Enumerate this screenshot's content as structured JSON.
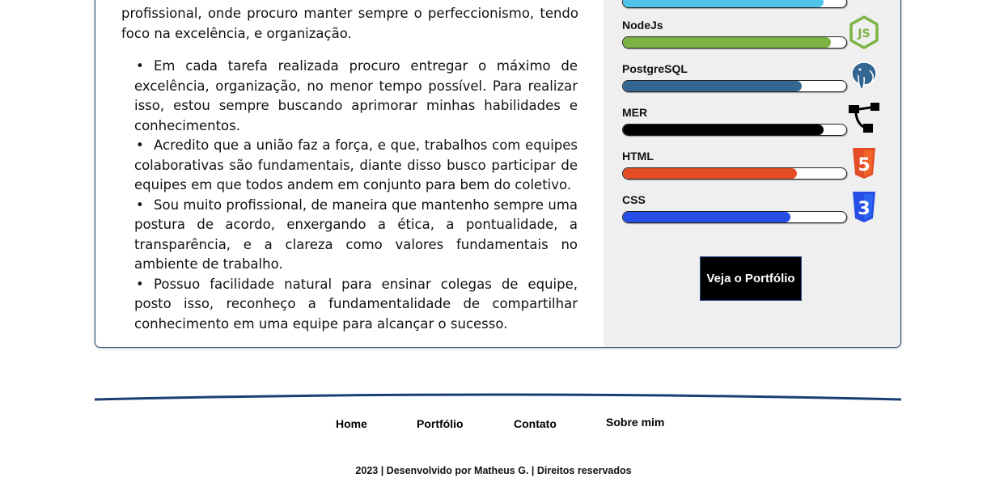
{
  "about": {
    "intro": "profissional, onde procuro manter sempre o perfeccionismo, tendo foco na excelência, e organização.",
    "bullets": [
      "Em cada tarefa realizada procuro entregar o máximo de excelência, organização, no menor tempo possível. Para realizar isso, estou sempre buscando aprimorar minhas habilidades e conhecimentos.",
      "Acredito que a união faz a força, e que, trabalhos com equipes colaborativas são fundamentais, diante disso busco participar de equipes em que todos andem em conjunto para bem do coletivo.",
      "Sou muito profissional, de maneira que mantenho sempre uma postura de acordo, enxergando a ética, a pontualidade, a transparência, e a clareza como valores fundamentais no ambiente de trabalho.",
      "Possuo facilidade natural para ensinar colegas de equipe, posto isso, reconheço a fundamentalidade de compartilhar conhecimento em uma equipe para alcançar o sucesso."
    ],
    "bullet_symbol": "•"
  },
  "skills": [
    {
      "name": "",
      "level": 0.9,
      "color": "#4ec4e8",
      "icon": "partial-skill-icon"
    },
    {
      "name": "NodeJs",
      "level": 0.93,
      "color": "#7cb342",
      "icon": "nodejs-icon"
    },
    {
      "name": "PostgreSQL",
      "level": 0.8,
      "color": "#336791",
      "icon": "postgresql-icon"
    },
    {
      "name": "MER",
      "level": 0.9,
      "color": "#000000",
      "icon": "mer-diagram-icon"
    },
    {
      "name": "HTML",
      "level": 0.78,
      "color": "#e44d26",
      "icon": "html5-icon"
    },
    {
      "name": "CSS",
      "level": 0.75,
      "color": "#264de4",
      "icon": "css3-icon"
    }
  ],
  "portfolio_button": "Veja o Portfólio",
  "footer": {
    "nav": [
      {
        "label": "Home"
      },
      {
        "label": "Portfólio"
      },
      {
        "label": "Contato"
      },
      {
        "label": "Sobre mim"
      }
    ],
    "copyright": "2023 | Desenvolvido por Matheus G. | Direitos reservados"
  },
  "colors": {
    "card_border": "#1c3f73",
    "right_panel_bg": "#efefef",
    "button_bg": "#000000",
    "button_border": "#2a5090"
  }
}
